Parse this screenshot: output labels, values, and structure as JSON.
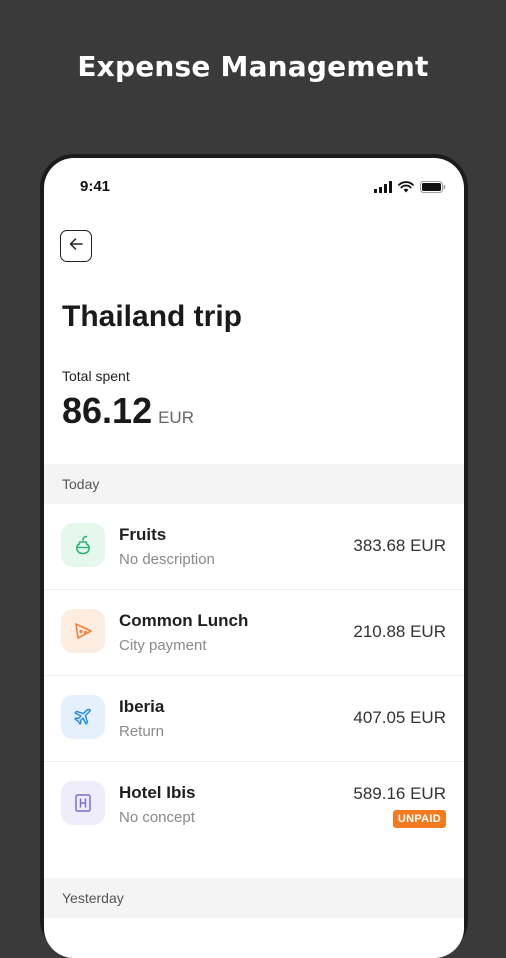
{
  "promo": {
    "headline": "Expense Management"
  },
  "status_bar": {
    "time": "9:41",
    "icons": [
      "signal-icon",
      "wifi-icon",
      "battery-icon"
    ]
  },
  "header": {
    "back_icon": "arrow-left-icon",
    "title": "Thailand trip"
  },
  "summary": {
    "label": "Total spent",
    "amount": "86.12",
    "currency": "EUR"
  },
  "sections": [
    {
      "label": "Today",
      "expenses": [
        {
          "name": "Fruits",
          "description": "No description",
          "amount": "383.68 EUR",
          "icon": "fruit-icon",
          "icon_color": "#2bb673",
          "icon_bg": "#e6f7ee",
          "badge": ""
        },
        {
          "name": "Common Lunch",
          "description": "City payment",
          "amount": "210.88 EUR",
          "icon": "food-slice-icon",
          "icon_color": "#f4813a",
          "icon_bg": "#fdece0",
          "badge": ""
        },
        {
          "name": "Iberia",
          "description": "Return",
          "amount": "407.05 EUR",
          "icon": "airplane-icon",
          "icon_color": "#2a8de0",
          "icon_bg": "#e4f1fc",
          "badge": ""
        },
        {
          "name": "Hotel Ibis",
          "description": "No concept",
          "amount": "589.16 EUR",
          "icon": "hotel-icon",
          "icon_color": "#7b6cd9",
          "icon_bg": "#efecfb",
          "badge": "UNPAID",
          "badge_color": "#f47a20"
        }
      ]
    },
    {
      "label": "Yesterday",
      "expenses": []
    }
  ]
}
